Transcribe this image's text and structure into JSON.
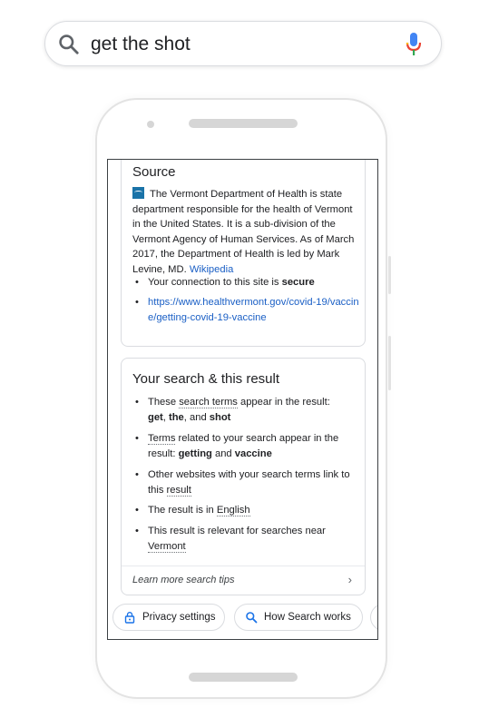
{
  "search": {
    "query": "get the shot"
  },
  "source_card": {
    "title": "Source",
    "description": "The Vermont Department of Health is state department responsible for the health of Vermont in the United States. It is a sub-division of the Vermont Agency of Human Services. As of March 2017, the Department of Health is led by Mark Levine, MD.",
    "wiki_link": "Wikipedia",
    "connection_text": "Your connection to this site is",
    "connection_status": "secure",
    "url": "https://www.healthvermont.gov/covid-19/vaccine/getting-covid-19-vaccine"
  },
  "result_card": {
    "title": "Your search & this result",
    "items": [
      {
        "pre": "These ",
        "dotted": "search terms",
        "post": " appear in the result:"
      },
      {
        "pre": "",
        "dotted": "Terms",
        "post": " related to your search appear in the result: "
      },
      {
        "pre": "Other websites with your search terms link to this ",
        "dotted": "result",
        "post": ""
      },
      {
        "pre": "The result is in ",
        "dotted": "English",
        "post": ""
      },
      {
        "pre": "This result is relevant for searches near ",
        "dotted": "Vermont",
        "post": ""
      }
    ],
    "terms": {
      "t1": "get",
      "t2": "the",
      "t3": "shot",
      "sep1": ", ",
      "sep2": ", and "
    },
    "related": {
      "r1": "getting",
      "and": " and ",
      "r2": "vaccine"
    },
    "learn_more": "Learn more search tips"
  },
  "chips": {
    "privacy": "Privacy settings",
    "how": "How Search works"
  },
  "icons": {
    "search": "search-icon",
    "mic": "microphone-icon",
    "lock": "lock-icon",
    "chevron": "chevron-right-icon"
  },
  "colors": {
    "link": "#1a5fc5",
    "favicon": "#1a73a8",
    "mic_blue": "#4285f4",
    "mic_red": "#ea4335",
    "mic_yellow": "#fbbc05",
    "mic_green": "#34a853"
  }
}
